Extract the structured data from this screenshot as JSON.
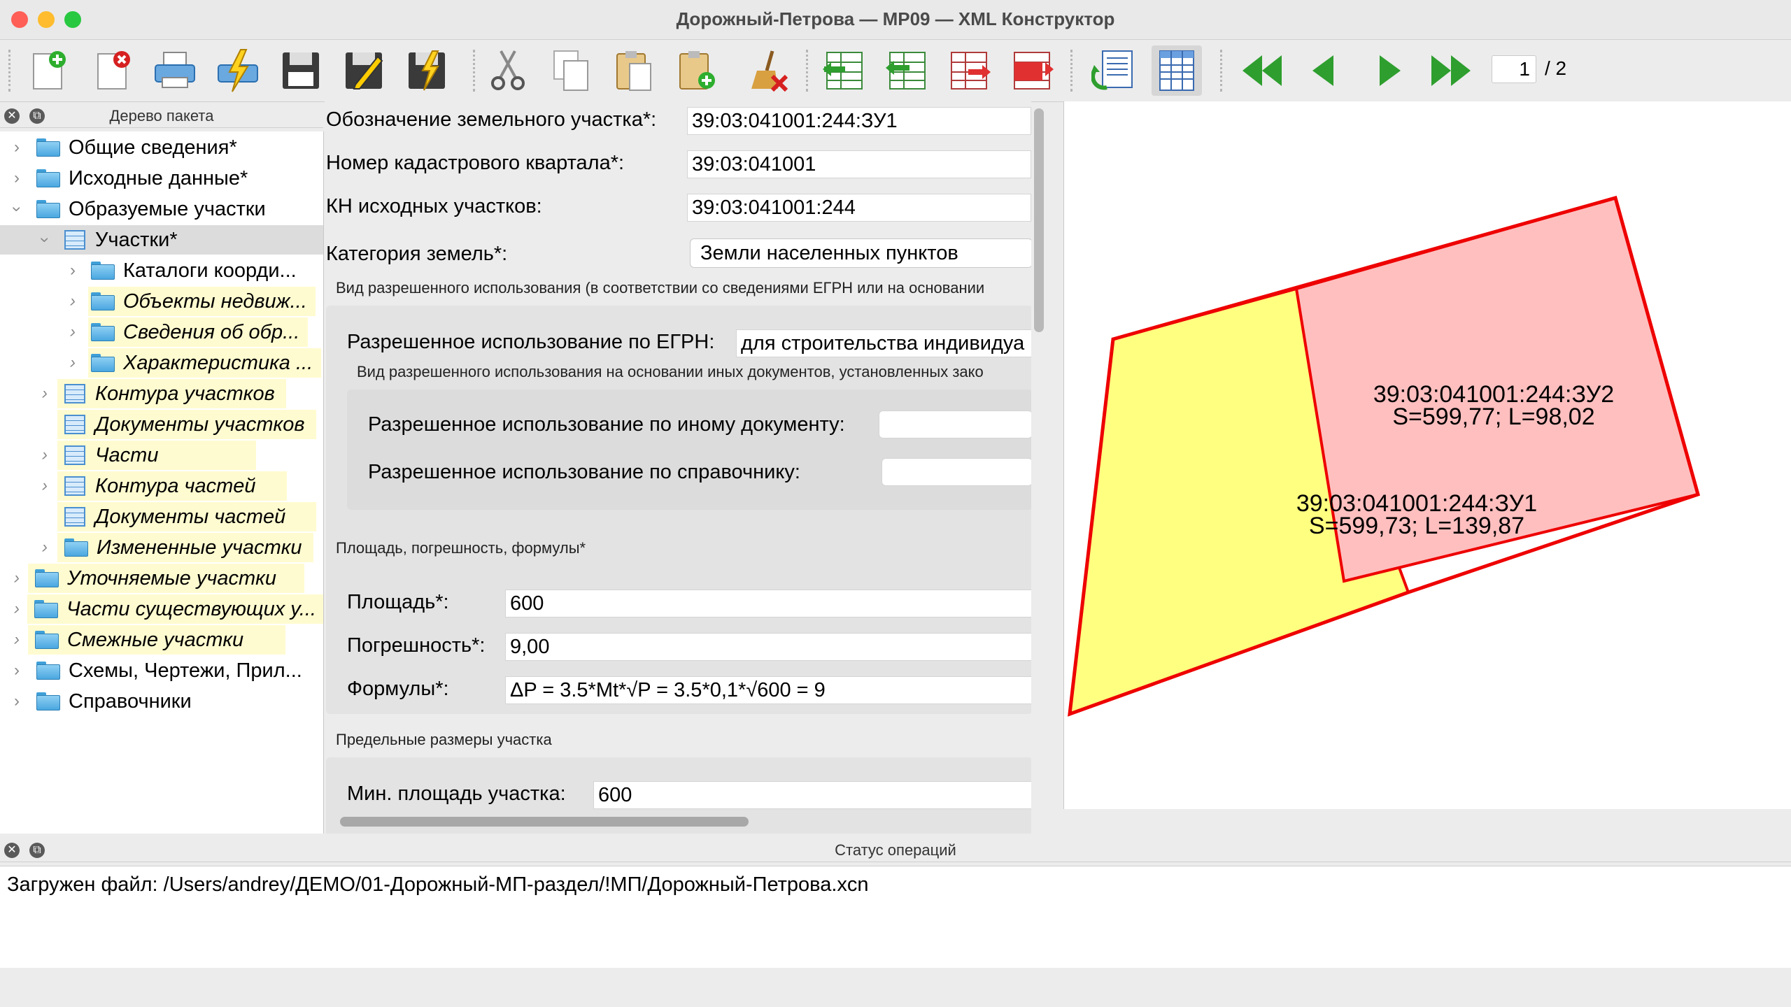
{
  "window": {
    "title": "Дорожный-Петрова — МР09 — XML Конструктор"
  },
  "toolbar": {
    "icons": [
      "new-doc-icon",
      "close-doc-icon",
      "print-icon",
      "validate-icon",
      "save-icon",
      "save-as-icon",
      "save-validate-icon",
      "cut-icon",
      "copy-icon",
      "paste-icon",
      "paste-new-icon",
      "clear-icon",
      "table-insert-left-icon",
      "table-insert-list-icon",
      "table-export-right-icon",
      "table-move-right-icon",
      "refresh-doc-icon",
      "table-view-icon",
      "first-page-icon",
      "prev-page-icon",
      "next-page-icon",
      "last-page-icon"
    ],
    "page_current": "1",
    "page_total": "/ 2",
    "accent_green": "#2e9e2e"
  },
  "tree_panel": {
    "title": "Дерево пакета",
    "items": [
      {
        "label": "Общие сведения*"
      },
      {
        "label": "Исходные данные*"
      },
      {
        "label": "Образуемые участки"
      },
      {
        "label": "Участки*"
      },
      {
        "label": "Каталоги коорди..."
      },
      {
        "label": "Объекты недвиж..."
      },
      {
        "label": "Сведения об обр..."
      },
      {
        "label": "Характеристика ..."
      },
      {
        "label": "Контура участков"
      },
      {
        "label": "Документы участков"
      },
      {
        "label": "Части"
      },
      {
        "label": "Контура частей"
      },
      {
        "label": "Документы частей"
      },
      {
        "label": "Измененные участки"
      },
      {
        "label": "Уточняемые участки"
      },
      {
        "label": "Части существующих у..."
      },
      {
        "label": "Смежные участки"
      },
      {
        "label": "Схемы, Чертежи, Прил..."
      },
      {
        "label": "Справочники"
      }
    ]
  },
  "form": {
    "designation_label": "Обозначение земельного участка*:",
    "designation_value": "39:03:041001:244:ЗУ1",
    "quarter_label": "Номер кадастрового квартала*:",
    "quarter_value": "39:03:041001",
    "source_label": "КН исходных участков:",
    "source_value": "39:03:041001:244",
    "category_label": "Категория земель*:",
    "category_value": "Земли населенных пунктов",
    "use_group_title": "Вид разрешенного использования (в соответствии со сведениями ЕГРН или на основании",
    "egrn_use_label": "Разрешенное использование по ЕГРН:",
    "egrn_use_value": "для строительства индивидуа",
    "other_docs_title": "Вид разрешенного использования на основании иных документов, установленных зако",
    "other_doc_label": "Разрешенное использование по иному документу:",
    "other_doc_value": "",
    "reference_label": "Разрешенное использование по справочнику:",
    "reference_value": "",
    "area_group_title": "Площадь, погрешность, формулы*",
    "area_label": "Площадь*:",
    "area_value": "600",
    "error_label": "Погрешность*:",
    "error_value": "9,00",
    "formula_label": "Формулы*:",
    "formula_value": "ΔP = 3.5*Mt*√P = 3.5*0,1*√600 = 9",
    "limits_group_title": "Предельные размеры участка",
    "min_area_label": "Мин. площадь участка:",
    "min_area_value": "600"
  },
  "map": {
    "parcel1": {
      "label": "39:03:041001:244:ЗУ1",
      "stats": "S=599,73; L=139,87",
      "fill": "#ffff80"
    },
    "parcel2": {
      "label": "39:03:041001:244:ЗУ2",
      "stats": "S=599,77; L=98,02",
      "fill": "#ffbfbf"
    },
    "outline": "#ee0000"
  },
  "status_panel": {
    "title": "Статус операций",
    "message": "Загружен файл: /Users/andrey/ДЕМО/01-Дорожный-МП-раздел/!МП/Дорожный-Петрова.xcn"
  }
}
